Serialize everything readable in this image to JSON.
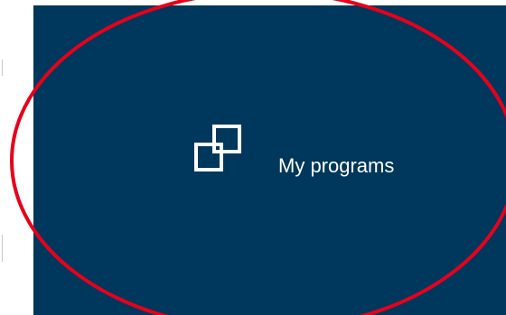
{
  "tile": {
    "label": "My programs",
    "icon": "copy-windows-icon",
    "background_color": "#00375c",
    "text_color": "#ffffff"
  },
  "annotation": {
    "shape": "ellipse",
    "color": "#e8001a"
  }
}
